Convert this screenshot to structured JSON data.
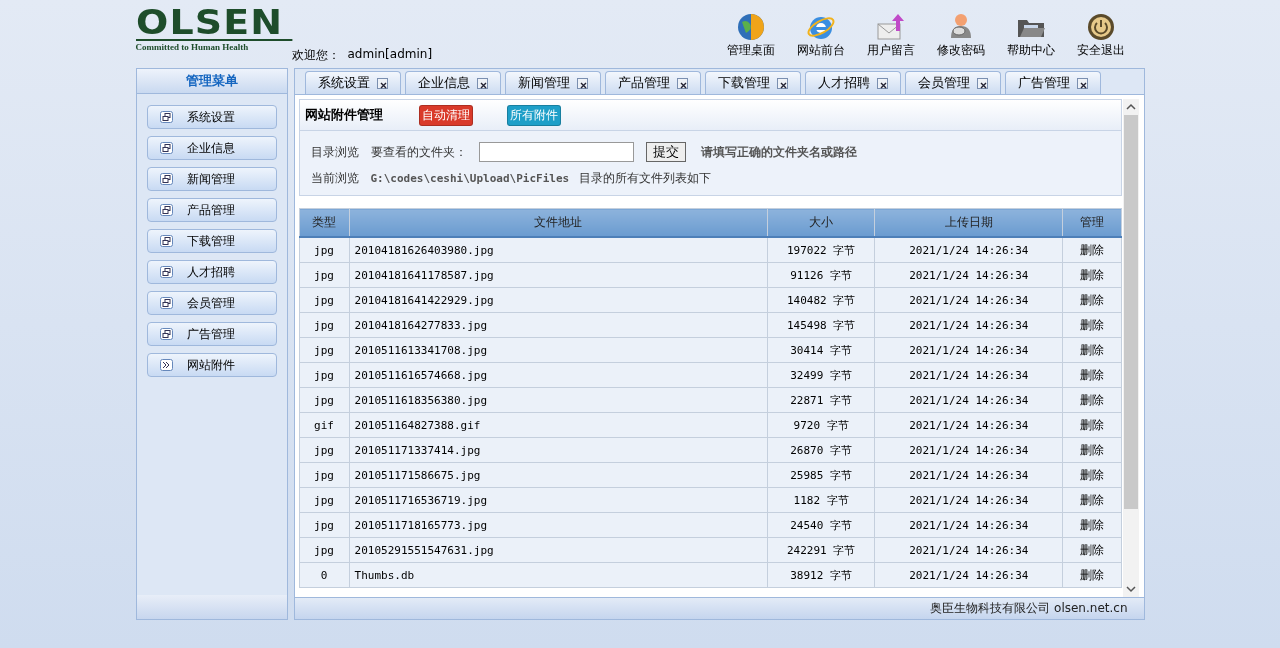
{
  "logo": {
    "name": "OLSEN",
    "tagline": "Committed to Human Health"
  },
  "welcome": {
    "label": "欢迎您：",
    "user": "admin[admin]"
  },
  "top_menu": [
    {
      "label": "管理桌面"
    },
    {
      "label": "网站前台"
    },
    {
      "label": "用户留言"
    },
    {
      "label": "修改密码"
    },
    {
      "label": "帮助中心"
    },
    {
      "label": "安全退出"
    }
  ],
  "sidebar": {
    "title": "管理菜单",
    "items": [
      {
        "label": "系统设置",
        "selected": false
      },
      {
        "label": "企业信息",
        "selected": false
      },
      {
        "label": "新闻管理",
        "selected": false
      },
      {
        "label": "产品管理",
        "selected": false
      },
      {
        "label": "下载管理",
        "selected": false
      },
      {
        "label": "人才招聘",
        "selected": false
      },
      {
        "label": "会员管理",
        "selected": false
      },
      {
        "label": "广告管理",
        "selected": false
      },
      {
        "label": "网站附件",
        "selected": true
      }
    ]
  },
  "tabs": [
    {
      "label": "系统设置"
    },
    {
      "label": "企业信息"
    },
    {
      "label": "新闻管理"
    },
    {
      "label": "产品管理"
    },
    {
      "label": "下载管理"
    },
    {
      "label": "人才招聘"
    },
    {
      "label": "会员管理"
    },
    {
      "label": "广告管理"
    }
  ],
  "panel": {
    "title": "网站附件管理",
    "buttons": [
      {
        "label": "自动清理",
        "color": "#d93a2a"
      },
      {
        "label": "所有附件",
        "color": "#1e9fc8"
      }
    ],
    "browse_label": "目录浏览",
    "folder_label": "要查看的文件夹：",
    "submit": "提交",
    "hint": "请填写正确的文件夹名或路径",
    "current_label": "当前浏览",
    "current_path": "G:\\codes\\ceshi\\Upload\\PicFiles",
    "current_suffix": "目录的所有文件列表如下"
  },
  "table": {
    "columns": [
      "类型",
      "文件地址",
      "大小",
      "上传日期",
      "管理"
    ],
    "rows": [
      [
        "jpg",
        "20104181626403980.jpg",
        "197022 字节",
        "2021/1/24 14:26:34",
        "删除"
      ],
      [
        "jpg",
        "20104181641178587.jpg",
        "91126 字节",
        "2021/1/24 14:26:34",
        "删除"
      ],
      [
        "jpg",
        "20104181641422929.jpg",
        "140482 字节",
        "2021/1/24 14:26:34",
        "删除"
      ],
      [
        "jpg",
        "2010418164277833.jpg",
        "145498 字节",
        "2021/1/24 14:26:34",
        "删除"
      ],
      [
        "jpg",
        "2010511613341708.jpg",
        "30414 字节",
        "2021/1/24 14:26:34",
        "删除"
      ],
      [
        "jpg",
        "2010511616574668.jpg",
        "32499 字节",
        "2021/1/24 14:26:34",
        "删除"
      ],
      [
        "jpg",
        "2010511618356380.jpg",
        "22871 字节",
        "2021/1/24 14:26:34",
        "删除"
      ],
      [
        "gif",
        "201051164827388.gif",
        "9720 字节",
        "2021/1/24 14:26:34",
        "删除"
      ],
      [
        "jpg",
        "201051171337414.jpg",
        "26870 字节",
        "2021/1/24 14:26:34",
        "删除"
      ],
      [
        "jpg",
        "201051171586675.jpg",
        "25985 字节",
        "2021/1/24 14:26:34",
        "删除"
      ],
      [
        "jpg",
        "2010511716536719.jpg",
        "1182 字节",
        "2021/1/24 14:26:34",
        "删除"
      ],
      [
        "jpg",
        "2010511718165773.jpg",
        "24540 字节",
        "2021/1/24 14:26:34",
        "删除"
      ],
      [
        "jpg",
        "20105291551547631.jpg",
        "242291 字节",
        "2021/1/24 14:26:34",
        "删除"
      ],
      [
        "0",
        "Thumbs.db",
        "38912 字节",
        "2021/1/24 14:26:34",
        "删除"
      ]
    ]
  },
  "footer": "奥臣生物科技有限公司 olsen.net.cn"
}
